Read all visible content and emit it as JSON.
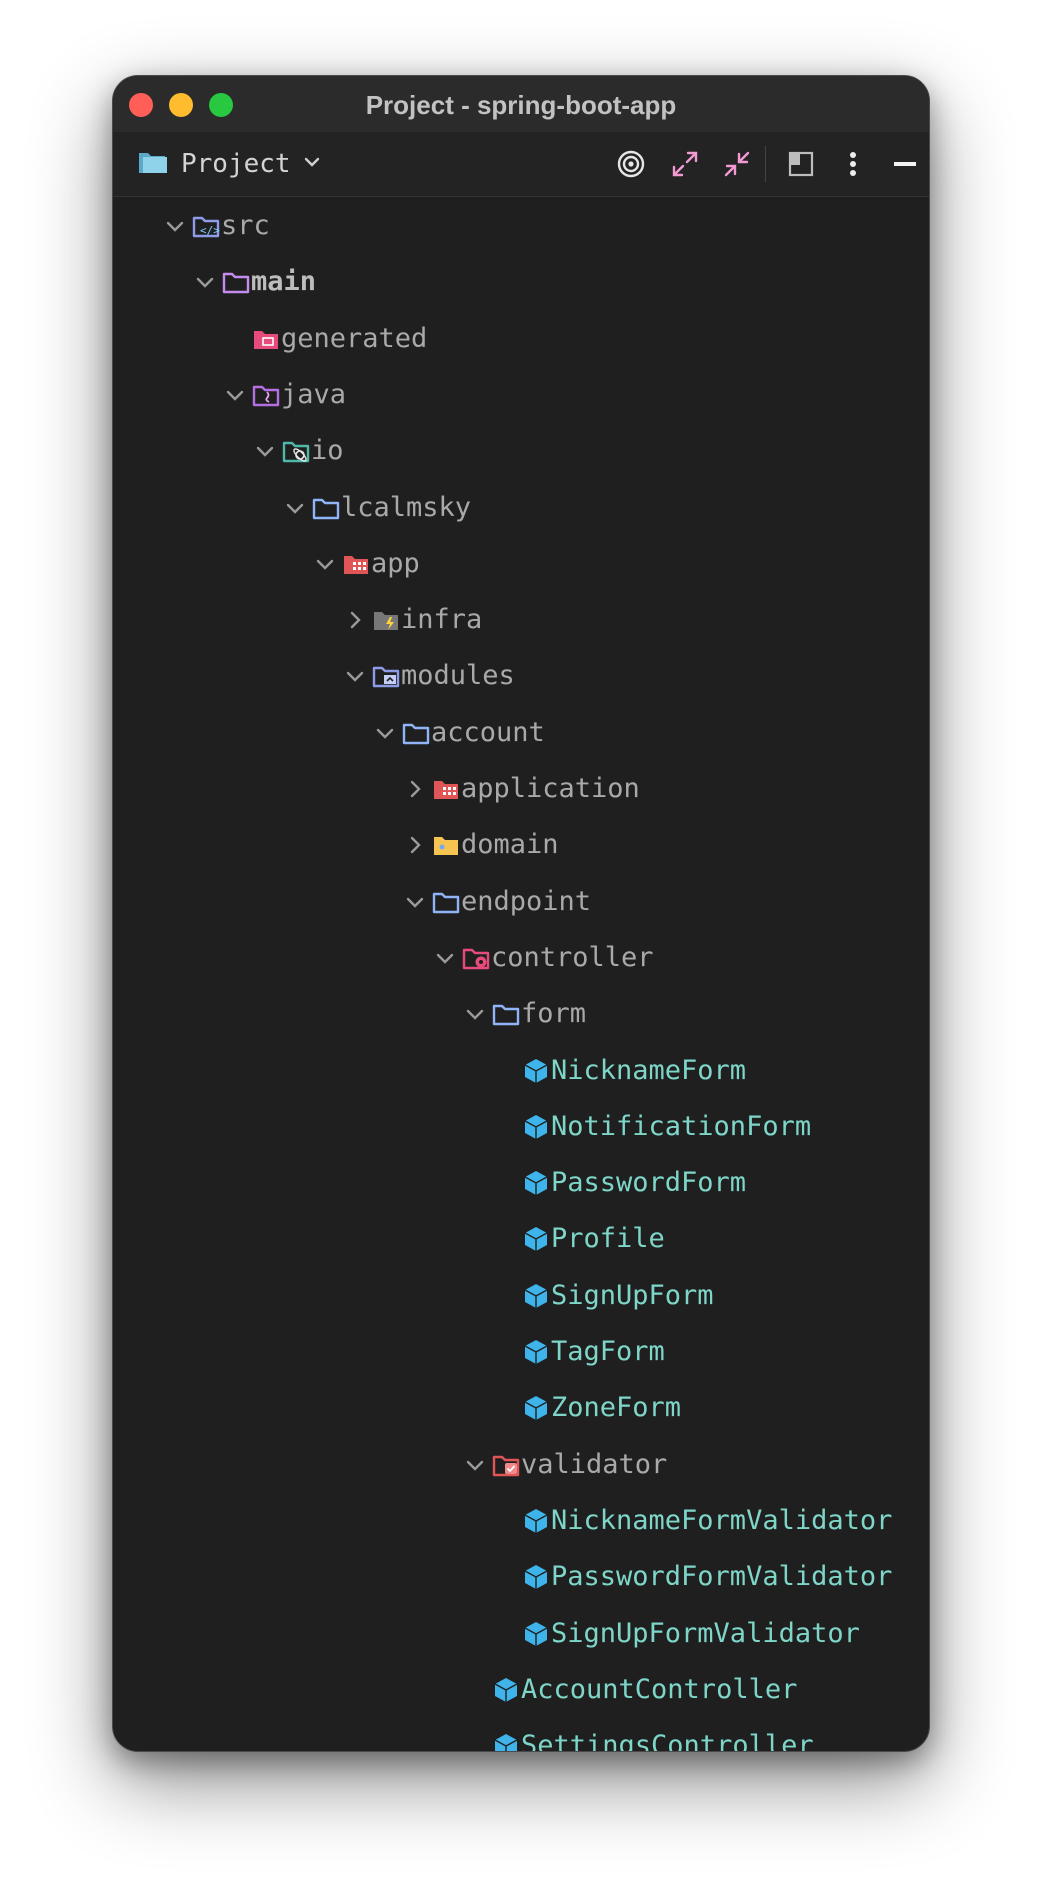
{
  "window": {
    "title": "Project - spring-boot-app"
  },
  "toolbar": {
    "view_label": "Project"
  },
  "tree": [
    {
      "label": "src",
      "depth": 0,
      "chevron": "down",
      "icon": "src-folder-icon"
    },
    {
      "label": "main",
      "depth": 1,
      "chevron": "down",
      "icon": "folder-purple-icon",
      "bold": true
    },
    {
      "label": "generated",
      "depth": 2,
      "chevron": "none",
      "icon": "generated-folder-icon"
    },
    {
      "label": "java",
      "depth": 2,
      "chevron": "down",
      "icon": "java-folder-icon"
    },
    {
      "label": "io",
      "depth": 3,
      "chevron": "down",
      "icon": "package-folder-icon"
    },
    {
      "label": "lcalmsky",
      "depth": 4,
      "chevron": "down",
      "icon": "folder-blue-icon"
    },
    {
      "label": "app",
      "depth": 5,
      "chevron": "down",
      "icon": "app-folder-icon"
    },
    {
      "label": "infra",
      "depth": 6,
      "chevron": "right",
      "icon": "infra-folder-icon"
    },
    {
      "label": "modules",
      "depth": 6,
      "chevron": "down",
      "icon": "modules-folder-icon"
    },
    {
      "label": "account",
      "depth": 7,
      "chevron": "down",
      "icon": "folder-blue-icon"
    },
    {
      "label": "application",
      "depth": 8,
      "chevron": "right",
      "icon": "app-folder-icon"
    },
    {
      "label": "domain",
      "depth": 8,
      "chevron": "right",
      "icon": "domain-folder-icon"
    },
    {
      "label": "endpoint",
      "depth": 8,
      "chevron": "down",
      "icon": "folder-blue-icon"
    },
    {
      "label": "controller",
      "depth": 9,
      "chevron": "down",
      "icon": "controller-folder-icon"
    },
    {
      "label": "form",
      "depth": 10,
      "chevron": "down",
      "icon": "folder-blue-icon"
    },
    {
      "label": "NicknameForm",
      "depth": 11,
      "chevron": "none",
      "icon": "class-icon",
      "cls": true
    },
    {
      "label": "NotificationForm",
      "depth": 11,
      "chevron": "none",
      "icon": "class-icon",
      "cls": true
    },
    {
      "label": "PasswordForm",
      "depth": 11,
      "chevron": "none",
      "icon": "class-icon",
      "cls": true
    },
    {
      "label": "Profile",
      "depth": 11,
      "chevron": "none",
      "icon": "class-icon",
      "cls": true
    },
    {
      "label": "SignUpForm",
      "depth": 11,
      "chevron": "none",
      "icon": "class-icon",
      "cls": true
    },
    {
      "label": "TagForm",
      "depth": 11,
      "chevron": "none",
      "icon": "class-icon",
      "cls": true
    },
    {
      "label": "ZoneForm",
      "depth": 11,
      "chevron": "none",
      "icon": "class-icon",
      "cls": true
    },
    {
      "label": "validator",
      "depth": 10,
      "chevron": "down",
      "icon": "validator-folder-icon"
    },
    {
      "label": "NicknameFormValidator",
      "depth": 11,
      "chevron": "none",
      "icon": "class-icon",
      "cls": true
    },
    {
      "label": "PasswordFormValidator",
      "depth": 11,
      "chevron": "none",
      "icon": "class-icon",
      "cls": true
    },
    {
      "label": "SignUpFormValidator",
      "depth": 11,
      "chevron": "none",
      "icon": "class-icon",
      "cls": true
    },
    {
      "label": "AccountController",
      "depth": 10,
      "chevron": "none",
      "icon": "class-icon",
      "cls": true
    },
    {
      "label": "SettingsController",
      "depth": 10,
      "chevron": "none",
      "icon": "class-icon",
      "cls": true
    }
  ]
}
